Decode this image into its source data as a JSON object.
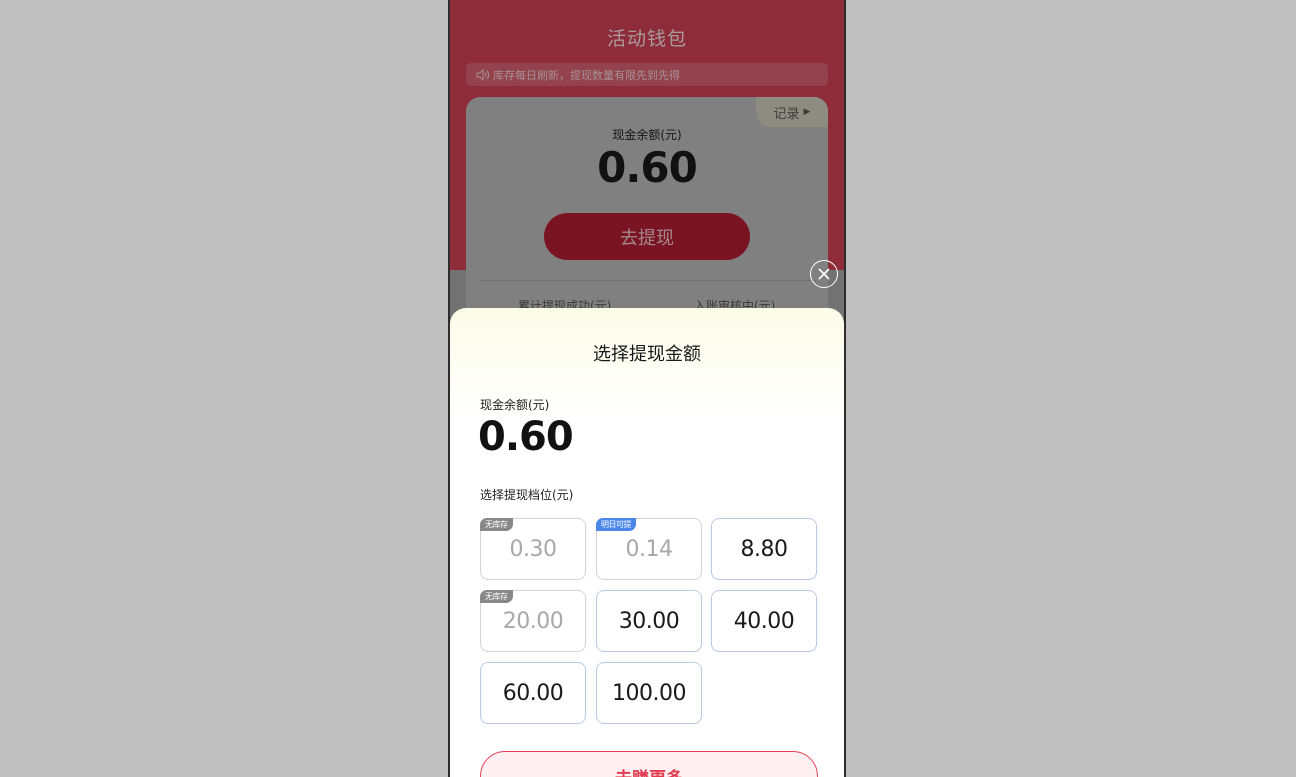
{
  "page": {
    "title": "活动钱包",
    "notice": "库存每日刷新，提现数量有限先到先得"
  },
  "wallet_card": {
    "record_label": "记录",
    "balance_label": "现金余额(元)",
    "balance_value": "0.60",
    "withdraw_button": "去提现",
    "stat_left_label": "累计提现成功(元)",
    "stat_right_label": "入账审核中(元)"
  },
  "sheet": {
    "title": "选择提现金额",
    "balance_label": "现金余额(元)",
    "balance_value": "0.60",
    "tier_label": "选择提现档位(元)",
    "tiers": [
      {
        "amount": "0.30",
        "badge": "无库存",
        "disabled": true
      },
      {
        "amount": "0.14",
        "badge": "明日可提",
        "disabled": true
      },
      {
        "amount": "8.80",
        "badge": "",
        "disabled": false
      },
      {
        "amount": "20.00",
        "badge": "无库存",
        "disabled": true
      },
      {
        "amount": "30.00",
        "badge": "",
        "disabled": false
      },
      {
        "amount": "40.00",
        "badge": "",
        "disabled": false
      },
      {
        "amount": "60.00",
        "badge": "",
        "disabled": false
      },
      {
        "amount": "100.00",
        "badge": "",
        "disabled": false
      }
    ],
    "earn_more_button": "去赚更多"
  },
  "colors": {
    "brand_red": "#d24155",
    "accent_blue_badge": "#4a86e8",
    "sold_out_badge": "#888888"
  }
}
